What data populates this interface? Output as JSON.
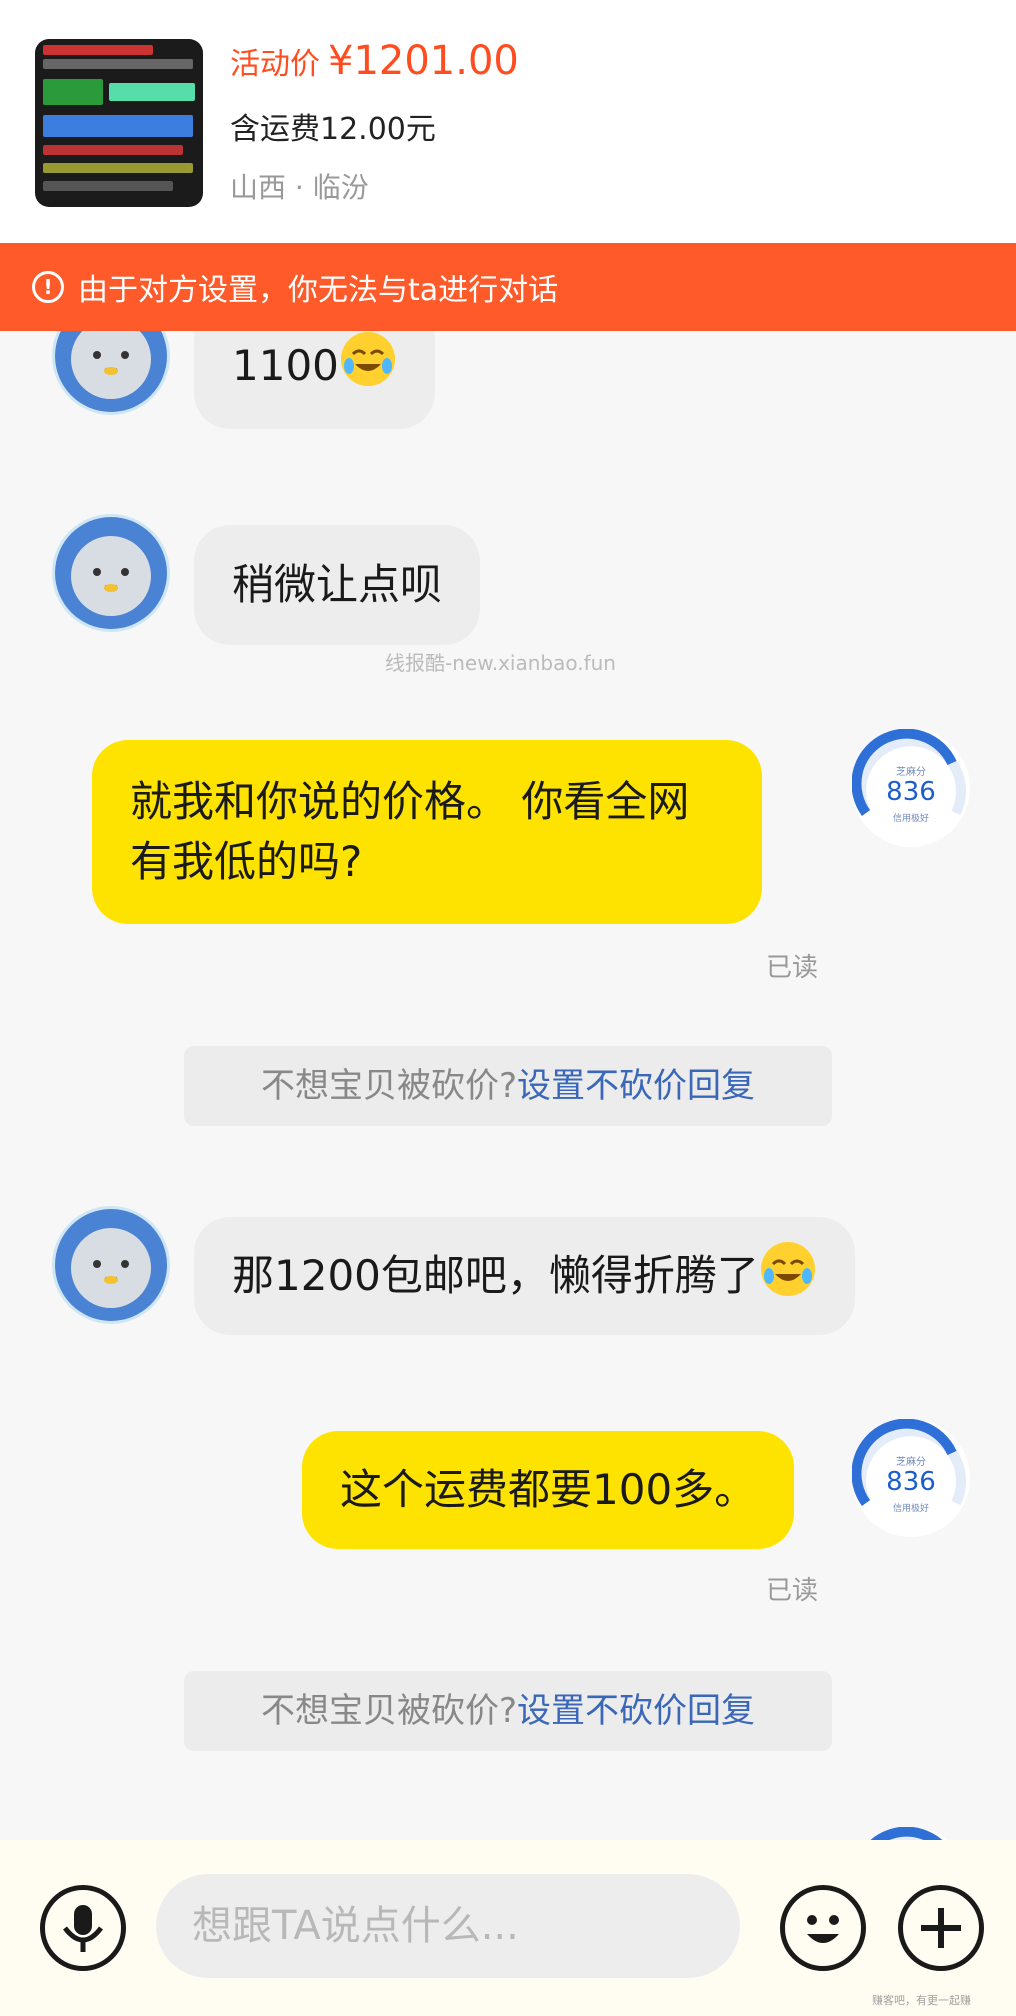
{
  "product": {
    "price_label": "活动价",
    "price": "¥1201.00",
    "shipping": "含运费12.00元",
    "location": "山西 · 临汾"
  },
  "warning": {
    "text": "由于对方设置，你无法与ta进行对话"
  },
  "messages": [
    {
      "side": "in",
      "text": "1100",
      "emoji": "crying-laughing"
    },
    {
      "side": "in",
      "text": "稍微让点呗"
    },
    {
      "side": "out",
      "lines": [
        "就我和你说的价格。 你看全网",
        "有我低的吗?"
      ],
      "status": "已读"
    },
    {
      "side": "tip",
      "prefix": "不想宝贝被砍价?",
      "link": "设置不砍价回复"
    },
    {
      "side": "in",
      "text": "那1200包邮吧，懒得折腾了",
      "emoji": "crying-laughing"
    },
    {
      "side": "out",
      "text": "这个运费都要100多。",
      "status": "已读"
    },
    {
      "side": "tip",
      "prefix": "不想宝贝被砍价?",
      "link": "设置不砍价回复"
    }
  ],
  "sesame_badge": {
    "label": "芝麻分",
    "score": "836",
    "rating": "信用极好"
  },
  "watermark": "线报酷-new.xianbao.fun",
  "input": {
    "placeholder": "想跟TA说点什么..."
  },
  "corner_watermark": "赚客吧，有更一起赚",
  "colors": {
    "accent_orange": "#ff5a2a",
    "price_red": "#ff4d1f",
    "bubble_out": "#ffe300",
    "bubble_in": "#ededed",
    "link_blue": "#3a67b8"
  }
}
